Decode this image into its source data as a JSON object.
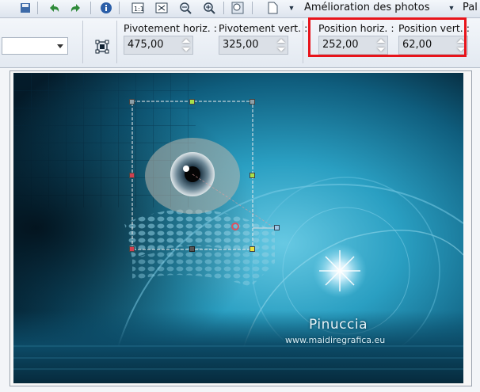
{
  "menu": {
    "enhance_photo_label": "Amélioration des photos",
    "palettes_label": "Pal"
  },
  "toolbar_icons": [
    "save-icon",
    "undo-icon",
    "redo-icon",
    "info-icon",
    "actual-size-icon",
    "fit-window-icon",
    "zoom-out-icon",
    "zoom-in-icon",
    "zoom-more-icon",
    "new-document-icon"
  ],
  "options": {
    "rotation_h": {
      "label": "Pivotement horiz. :",
      "value": "475,00"
    },
    "rotation_v": {
      "label": "Pivotement vert. :",
      "value": "325,00"
    },
    "position_h": {
      "label": "Position horiz. :",
      "value": "252,00"
    },
    "position_v": {
      "label": "Position vert. :",
      "value": "62,00"
    }
  },
  "watermark": {
    "name": "Pinuccia",
    "url": "www.maidiregrafica.eu"
  },
  "colors": {
    "highlight": "#e8141b",
    "image_teal": "#1d8fb0"
  }
}
